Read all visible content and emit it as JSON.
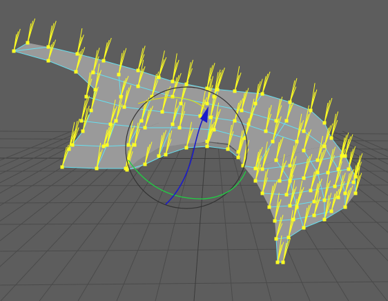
{
  "viewport": {
    "view": "perspective",
    "background_color": "#5d5d5d",
    "grid_color": "#4a4a4a",
    "grid_major_color": "#3a3a3a"
  },
  "mesh": {
    "face_color": "#9a9a9a",
    "wire_color": "#66e0f0",
    "vertex_color": "#ffff22",
    "normal_color": "#ffff22",
    "display": "vertex-normals"
  },
  "manipulator": {
    "tool": "rotate",
    "x_ring_color": "#dd2222",
    "y_ring_color": "#22cc44",
    "z_ring_color": "#1a1acc",
    "view_ring_color": "#333333",
    "active_ring_color": "#e6e600"
  },
  "icons": [
    "rotate-manipulator-icon"
  ]
}
